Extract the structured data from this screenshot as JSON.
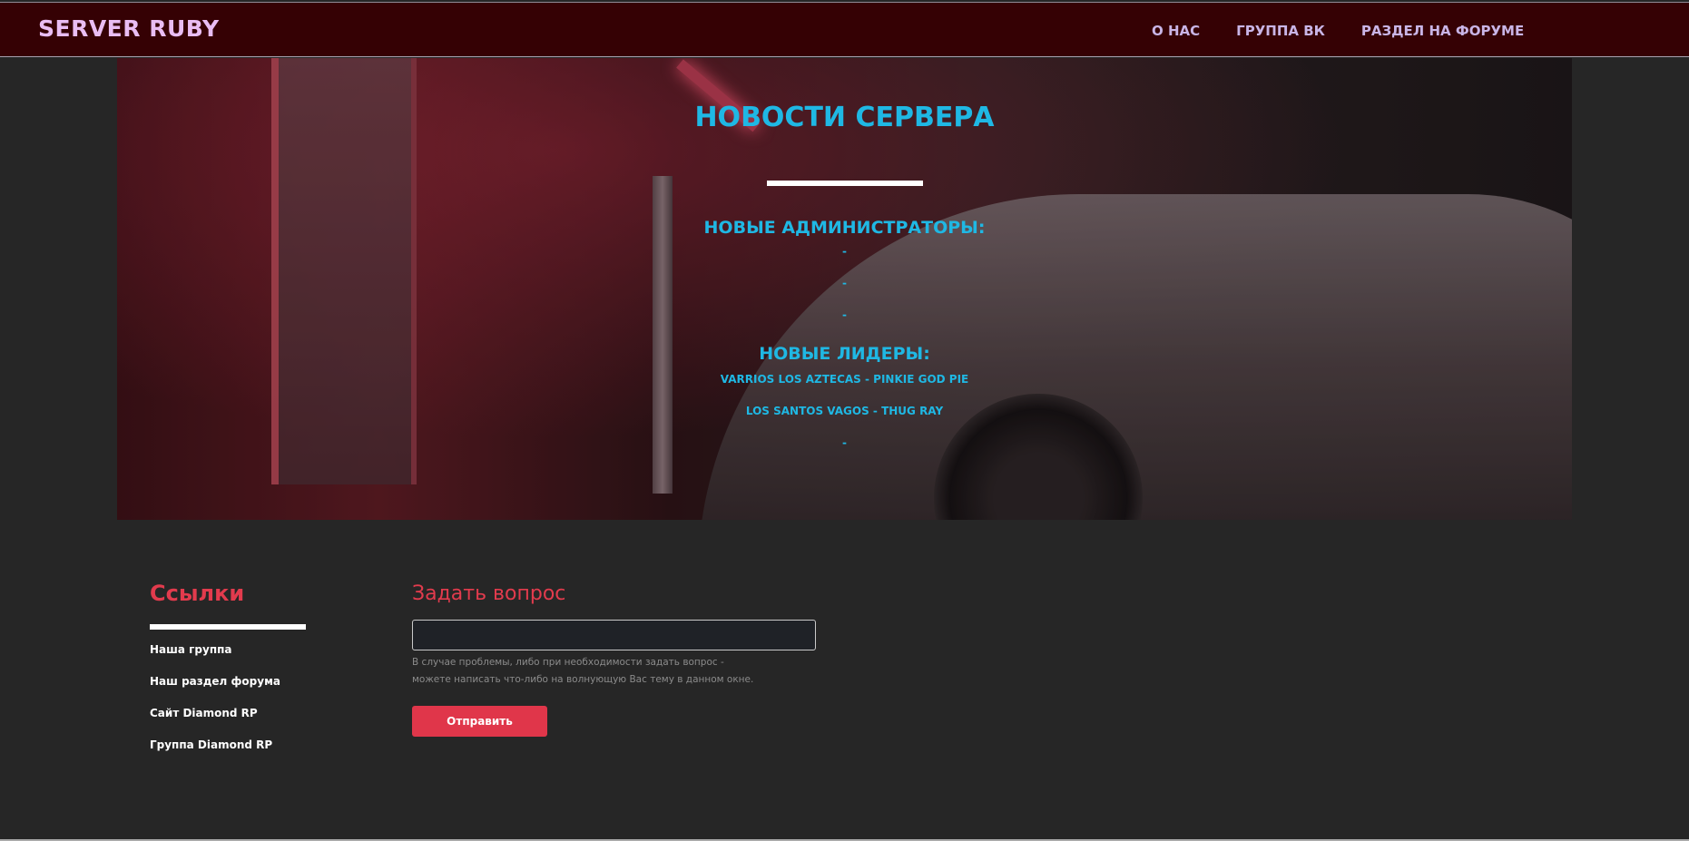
{
  "header": {
    "brand": "SERVER RUBY",
    "nav": [
      "О НАС",
      "ГРУППА ВК",
      "РАЗДЕЛ НА ФОРУМЕ"
    ]
  },
  "hero": {
    "title": "НОВОСТИ СЕРВЕРА",
    "admins_heading": "НОВЫЕ АДМИНИСТРАТОРЫ:",
    "admins": [
      "-",
      "-",
      "-"
    ],
    "leaders_heading": "НОВЫЕ ЛИДЕРЫ:",
    "leaders": [
      "VARRIOS LOS AZTECAS - PINKIE GOD PIE",
      "LOS SANTOS VAGOS - THUG RAY",
      "-"
    ]
  },
  "links": {
    "title": "Ссылки",
    "items": [
      "Наша группа",
      "Наш раздел форума",
      "Сайт Diamond RP",
      "Группа Diamond RP"
    ]
  },
  "ask": {
    "title": "Задать вопрос",
    "input_value": "",
    "input_placeholder": "",
    "hint_line1": "В случае проблемы, либо при необходимости задать вопрос -",
    "hint_line2": "можете написать что-либо на волнующую Вас тему в данном окне.",
    "send_label": "Отправить"
  },
  "colors": {
    "header_bg": "#350104",
    "brand": "#e9bdf3",
    "nav": "#c9b5e6",
    "accent_cyan": "#1fb8e4",
    "accent_red": "#e23b4d",
    "page_bg": "#262626"
  }
}
